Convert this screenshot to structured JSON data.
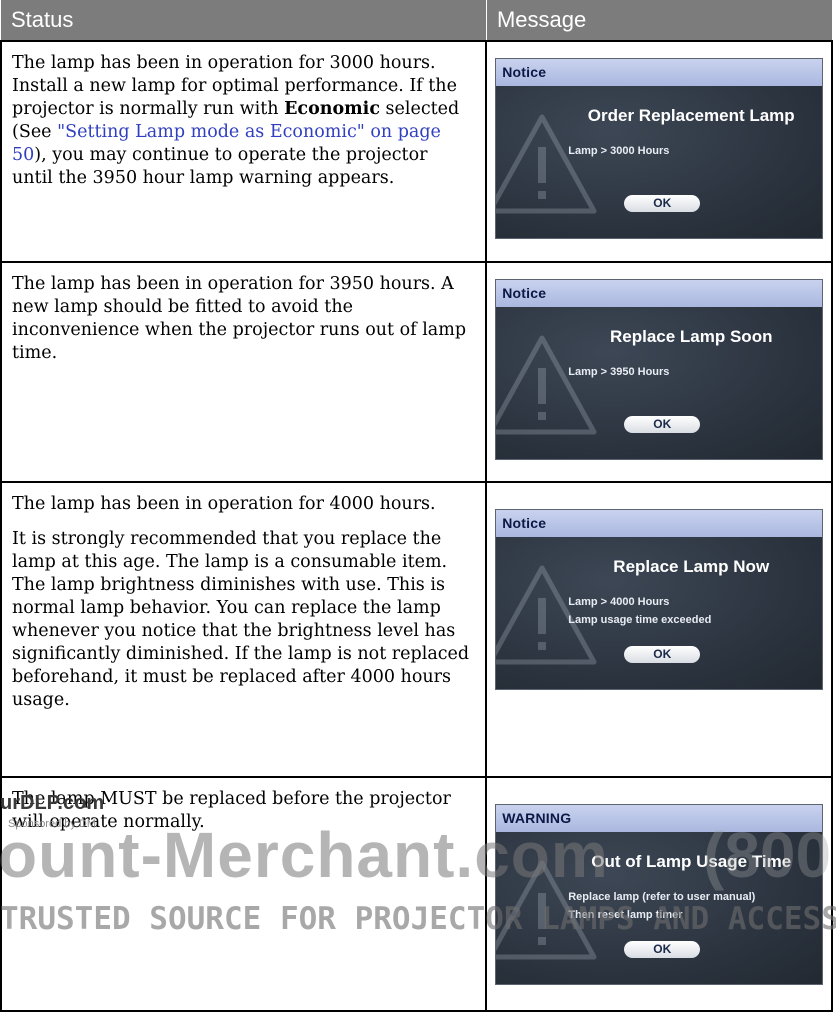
{
  "header": {
    "status": "Status",
    "message": "Message"
  },
  "rows": [
    {
      "status_parts": [
        "The lamp has been in operation for 3000 hours. Install a new lamp for optimal performance. If the projector is normally run with ",
        "Economic",
        " selected (See ",
        "\"Setting Lamp mode as Economic\" on page 50",
        "), you may continue to operate the projector until the 3950 hour lamp warning appears."
      ],
      "osd": {
        "bar": "Notice",
        "title": "Order Replacement Lamp",
        "line1": "Lamp > 3000 Hours",
        "line2": "",
        "ok": "OK"
      }
    },
    {
      "status_parts": [
        "The lamp has been in operation for 3950 hours. A new lamp should be fitted to avoid the inconvenience when the projector runs out of lamp time."
      ],
      "osd": {
        "bar": "Notice",
        "title": "Replace Lamp Soon",
        "line1": "Lamp > 3950 Hours",
        "line2": "",
        "ok": "OK"
      }
    },
    {
      "status_parts": [
        "The lamp has been in operation for 4000 hours.",
        "It is strongly recommended that you replace the lamp at this age. The lamp is a consumable item. The lamp brightness diminishes with use. This is normal lamp behavior. You can replace the lamp whenever you notice that the brightness level has significantly diminished. If the lamp is not replaced beforehand, it must be replaced after 4000 hours usage."
      ],
      "osd": {
        "bar": "Notice",
        "title": "Replace Lamp Now",
        "line1": "Lamp > 4000 Hours",
        "line2": "Lamp usage time exceeded",
        "ok": "OK"
      }
    },
    {
      "status_parts": [
        "The lamp MUST be replaced before the projector will operate normally."
      ],
      "osd": {
        "bar": "WARNING",
        "title": "Out of Lamp Usage Time",
        "line1": "Replace lamp (refer to user manual)",
        "line2": "Then reset lamp timer",
        "ok": "OK"
      }
    }
  ],
  "watermark": {
    "site": "urDLP.com",
    "sponsor": "Sponsored by DM",
    "brand": "ount-Merchant.com",
    "phone": "(800",
    "tagline": "TRUSTED SOURCE FOR PROJECTOR LAMPS AND ACCESSORIES"
  }
}
